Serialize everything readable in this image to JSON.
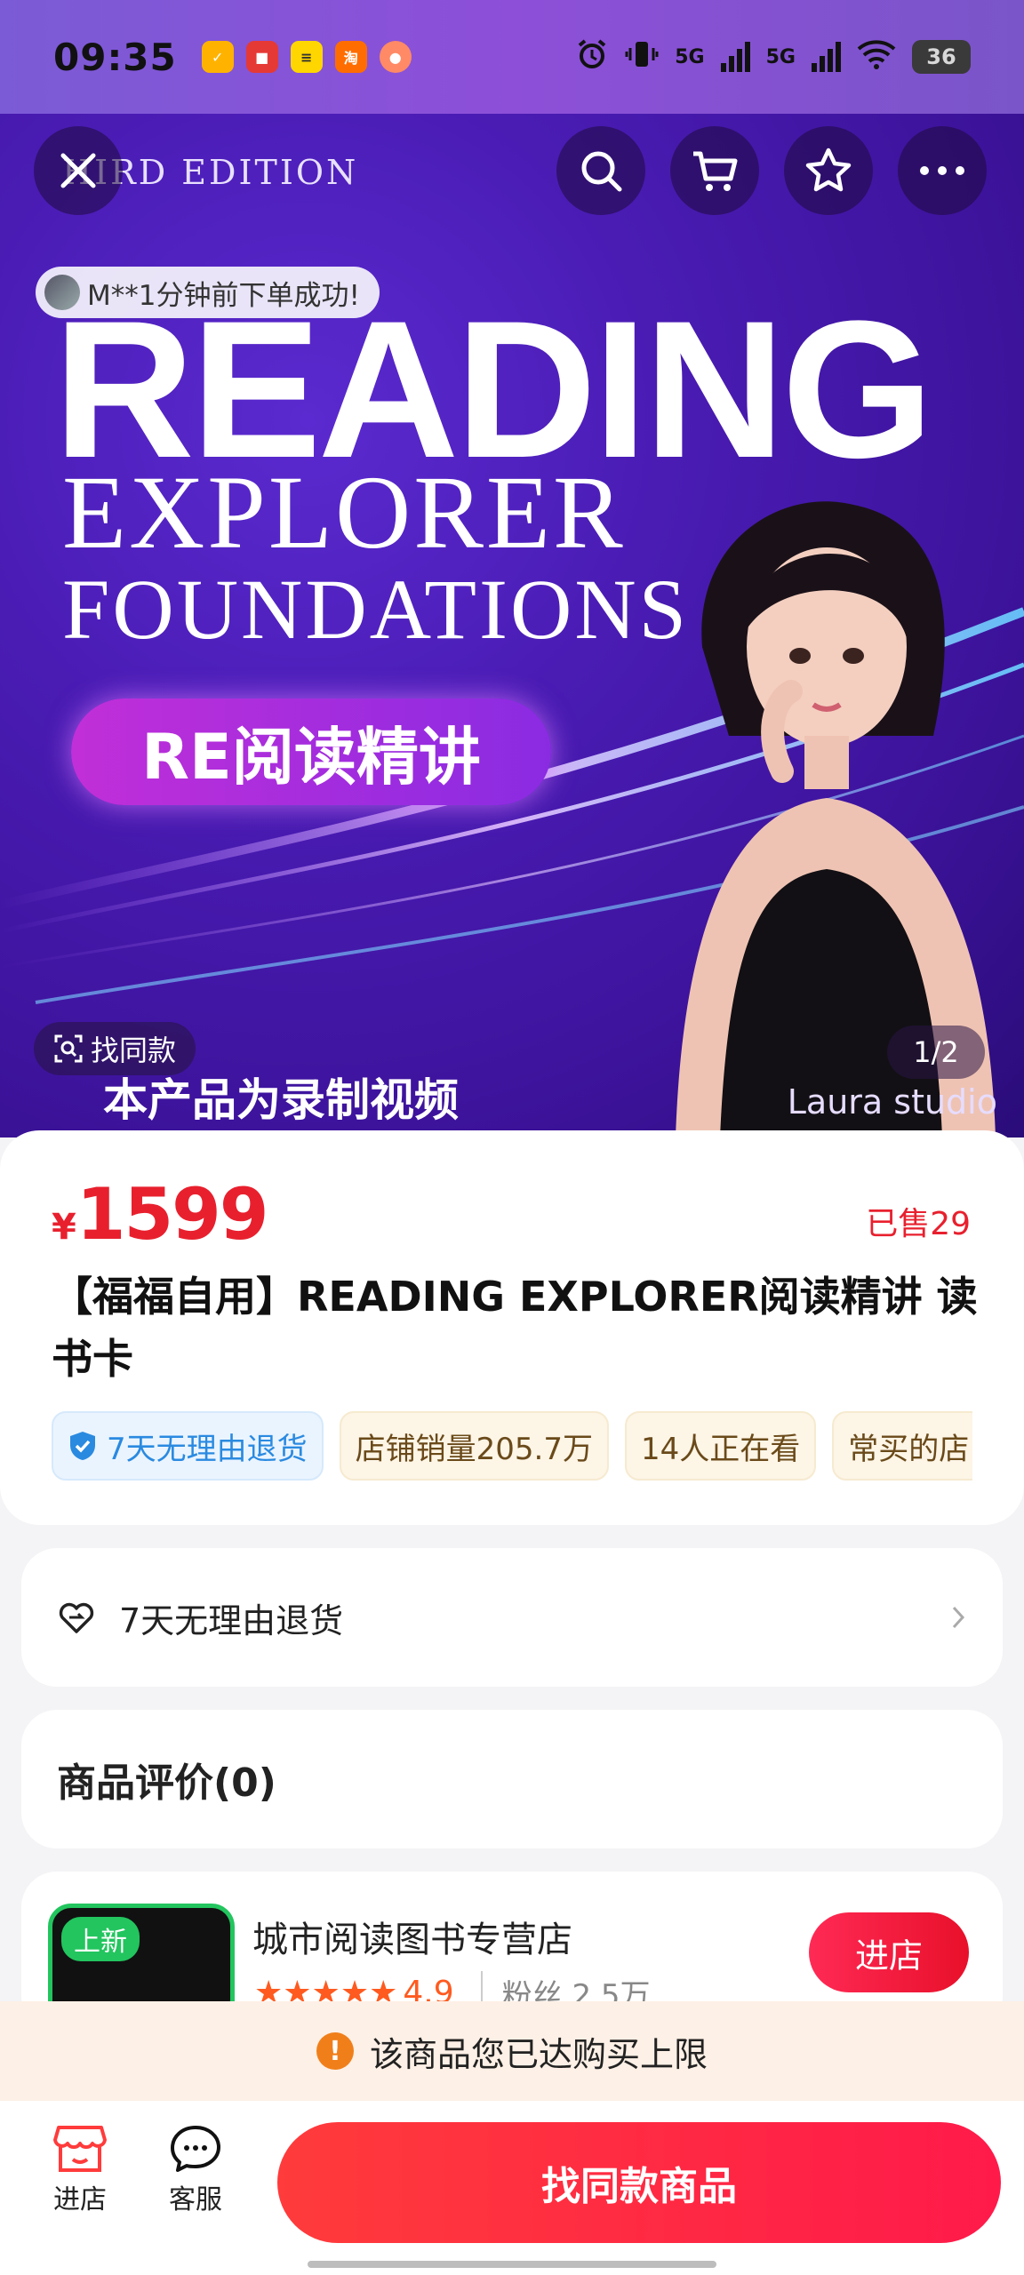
{
  "status_bar": {
    "time": "09:35",
    "network1": "5G",
    "network2": "5G",
    "battery": "36"
  },
  "hero": {
    "edition_text": "HIRD EDITION",
    "title_line1": "READING",
    "title_line2": "EXPLORER",
    "title_line3": "FOUNDATIONS",
    "badge_text": "RE阅读精讲",
    "order_notice": "M**1分钟前下单成功!",
    "find_same_label": "找同款",
    "recorded_note": "本产品为录制视频",
    "page_indicator": "1/2",
    "studio_label": "Laura studio"
  },
  "product": {
    "currency": "¥",
    "price": "1599",
    "sold": "已售29",
    "title": "【福福自用】READING EXPLORER阅读精讲 读书卡",
    "tags": [
      {
        "label": "7天无理由退货",
        "style": "blue"
      },
      {
        "label": "店铺销量205.7万",
        "style": "beige"
      },
      {
        "label": "14人正在看",
        "style": "beige"
      },
      {
        "label": "常买的店",
        "style": "beige"
      }
    ]
  },
  "service": {
    "return_label": "7天无理由退货"
  },
  "reviews": {
    "title": "商品评价(0)"
  },
  "store": {
    "badge": "上新",
    "name": "城市阅读图书专营店",
    "rating": "4.9",
    "fans": "粉丝 2.5万",
    "enter_label": "进店"
  },
  "notice": {
    "text": "该商品您已达购买上限"
  },
  "bottom_bar": {
    "store_label": "进店",
    "service_label": "客服",
    "main_button": "找同款商品"
  },
  "colors": {
    "accent_red": "#e8202e",
    "hero_purple": "#4a1cb4",
    "store_green": "#22c55e"
  }
}
